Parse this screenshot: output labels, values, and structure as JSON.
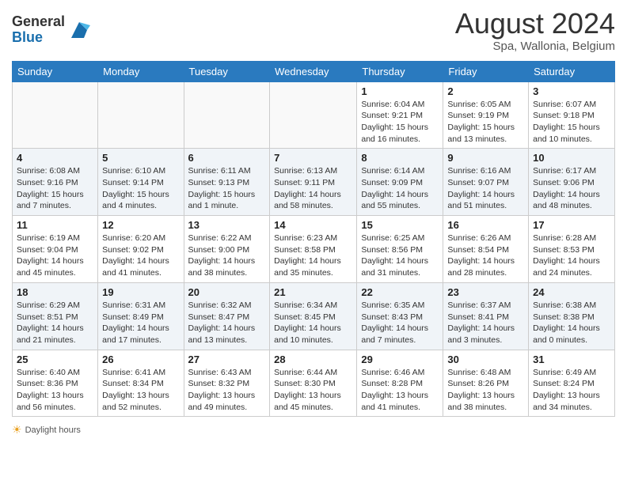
{
  "header": {
    "logo_general": "General",
    "logo_blue": "Blue",
    "title": "August 2024",
    "subtitle": "Spa, Wallonia, Belgium"
  },
  "weekdays": [
    "Sunday",
    "Monday",
    "Tuesday",
    "Wednesday",
    "Thursday",
    "Friday",
    "Saturday"
  ],
  "footer": {
    "daylight_label": "Daylight hours"
  },
  "weeks": [
    [
      {
        "day": "",
        "info": ""
      },
      {
        "day": "",
        "info": ""
      },
      {
        "day": "",
        "info": ""
      },
      {
        "day": "",
        "info": ""
      },
      {
        "day": "1",
        "info": "Sunrise: 6:04 AM\nSunset: 9:21 PM\nDaylight: 15 hours\nand 16 minutes."
      },
      {
        "day": "2",
        "info": "Sunrise: 6:05 AM\nSunset: 9:19 PM\nDaylight: 15 hours\nand 13 minutes."
      },
      {
        "day": "3",
        "info": "Sunrise: 6:07 AM\nSunset: 9:18 PM\nDaylight: 15 hours\nand 10 minutes."
      }
    ],
    [
      {
        "day": "4",
        "info": "Sunrise: 6:08 AM\nSunset: 9:16 PM\nDaylight: 15 hours\nand 7 minutes."
      },
      {
        "day": "5",
        "info": "Sunrise: 6:10 AM\nSunset: 9:14 PM\nDaylight: 15 hours\nand 4 minutes."
      },
      {
        "day": "6",
        "info": "Sunrise: 6:11 AM\nSunset: 9:13 PM\nDaylight: 15 hours\nand 1 minute."
      },
      {
        "day": "7",
        "info": "Sunrise: 6:13 AM\nSunset: 9:11 PM\nDaylight: 14 hours\nand 58 minutes."
      },
      {
        "day": "8",
        "info": "Sunrise: 6:14 AM\nSunset: 9:09 PM\nDaylight: 14 hours\nand 55 minutes."
      },
      {
        "day": "9",
        "info": "Sunrise: 6:16 AM\nSunset: 9:07 PM\nDaylight: 14 hours\nand 51 minutes."
      },
      {
        "day": "10",
        "info": "Sunrise: 6:17 AM\nSunset: 9:06 PM\nDaylight: 14 hours\nand 48 minutes."
      }
    ],
    [
      {
        "day": "11",
        "info": "Sunrise: 6:19 AM\nSunset: 9:04 PM\nDaylight: 14 hours\nand 45 minutes."
      },
      {
        "day": "12",
        "info": "Sunrise: 6:20 AM\nSunset: 9:02 PM\nDaylight: 14 hours\nand 41 minutes."
      },
      {
        "day": "13",
        "info": "Sunrise: 6:22 AM\nSunset: 9:00 PM\nDaylight: 14 hours\nand 38 minutes."
      },
      {
        "day": "14",
        "info": "Sunrise: 6:23 AM\nSunset: 8:58 PM\nDaylight: 14 hours\nand 35 minutes."
      },
      {
        "day": "15",
        "info": "Sunrise: 6:25 AM\nSunset: 8:56 PM\nDaylight: 14 hours\nand 31 minutes."
      },
      {
        "day": "16",
        "info": "Sunrise: 6:26 AM\nSunset: 8:54 PM\nDaylight: 14 hours\nand 28 minutes."
      },
      {
        "day": "17",
        "info": "Sunrise: 6:28 AM\nSunset: 8:53 PM\nDaylight: 14 hours\nand 24 minutes."
      }
    ],
    [
      {
        "day": "18",
        "info": "Sunrise: 6:29 AM\nSunset: 8:51 PM\nDaylight: 14 hours\nand 21 minutes."
      },
      {
        "day": "19",
        "info": "Sunrise: 6:31 AM\nSunset: 8:49 PM\nDaylight: 14 hours\nand 17 minutes."
      },
      {
        "day": "20",
        "info": "Sunrise: 6:32 AM\nSunset: 8:47 PM\nDaylight: 14 hours\nand 13 minutes."
      },
      {
        "day": "21",
        "info": "Sunrise: 6:34 AM\nSunset: 8:45 PM\nDaylight: 14 hours\nand 10 minutes."
      },
      {
        "day": "22",
        "info": "Sunrise: 6:35 AM\nSunset: 8:43 PM\nDaylight: 14 hours\nand 7 minutes."
      },
      {
        "day": "23",
        "info": "Sunrise: 6:37 AM\nSunset: 8:41 PM\nDaylight: 14 hours\nand 3 minutes."
      },
      {
        "day": "24",
        "info": "Sunrise: 6:38 AM\nSunset: 8:38 PM\nDaylight: 14 hours\nand 0 minutes."
      }
    ],
    [
      {
        "day": "25",
        "info": "Sunrise: 6:40 AM\nSunset: 8:36 PM\nDaylight: 13 hours\nand 56 minutes."
      },
      {
        "day": "26",
        "info": "Sunrise: 6:41 AM\nSunset: 8:34 PM\nDaylight: 13 hours\nand 52 minutes."
      },
      {
        "day": "27",
        "info": "Sunrise: 6:43 AM\nSunset: 8:32 PM\nDaylight: 13 hours\nand 49 minutes."
      },
      {
        "day": "28",
        "info": "Sunrise: 6:44 AM\nSunset: 8:30 PM\nDaylight: 13 hours\nand 45 minutes."
      },
      {
        "day": "29",
        "info": "Sunrise: 6:46 AM\nSunset: 8:28 PM\nDaylight: 13 hours\nand 41 minutes."
      },
      {
        "day": "30",
        "info": "Sunrise: 6:48 AM\nSunset: 8:26 PM\nDaylight: 13 hours\nand 38 minutes."
      },
      {
        "day": "31",
        "info": "Sunrise: 6:49 AM\nSunset: 8:24 PM\nDaylight: 13 hours\nand 34 minutes."
      }
    ]
  ]
}
